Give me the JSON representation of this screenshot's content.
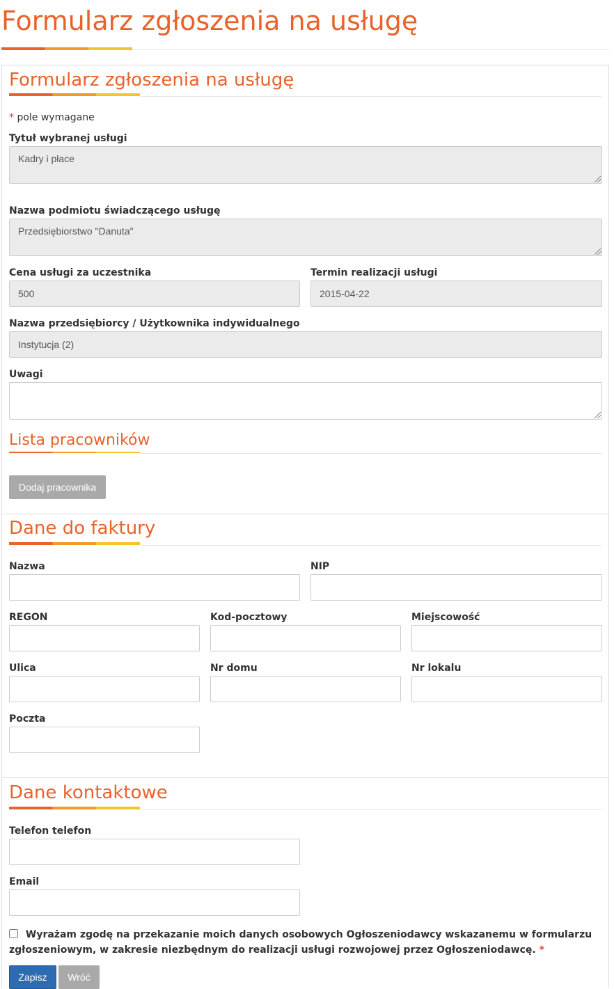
{
  "page": {
    "title": "Formularz zgłoszenia na usługę"
  },
  "form": {
    "title": "Formularz zgłoszenia na usługę",
    "required_note": "pole wymagane",
    "required_star": "*",
    "fields": {
      "service_title": {
        "label": "Tytuł wybranej usługi",
        "value": "Kadry i płace"
      },
      "provider_name": {
        "label": "Nazwa podmiotu świadczącego usługę",
        "value": "Przedsiębiorstwo \"Danuta\""
      },
      "price": {
        "label": "Cena usługi za uczestnika",
        "value": "500"
      },
      "deadline": {
        "label": "Termin realizacji usługi",
        "value": "2015-04-22"
      },
      "entrepreneur": {
        "label": "Nazwa przedsiębiorcy / Użytkownika indywidualnego",
        "value": "Instytucja (2)"
      },
      "notes": {
        "label": "Uwagi",
        "value": ""
      }
    }
  },
  "employees": {
    "title": "Lista pracowników",
    "add_button": "Dodaj pracownika"
  },
  "invoice": {
    "title": "Dane do faktury",
    "name": {
      "label": "Nazwa",
      "value": ""
    },
    "nip": {
      "label": "NIP",
      "value": ""
    },
    "regon": {
      "label": "REGON",
      "value": ""
    },
    "postal_code": {
      "label": "Kod-pocztowy",
      "value": ""
    },
    "city": {
      "label": "Miejscowość",
      "value": ""
    },
    "street": {
      "label": "Ulica",
      "value": ""
    },
    "house_no": {
      "label": "Nr domu",
      "value": ""
    },
    "apartment_no": {
      "label": "Nr lokalu",
      "value": ""
    },
    "post_office": {
      "label": "Poczta",
      "value": ""
    }
  },
  "contact": {
    "title": "Dane kontaktowe",
    "phone": {
      "label": "Telefon telefon",
      "value": ""
    },
    "email": {
      "label": "Email",
      "value": ""
    },
    "consent_text": "Wyrażam zgodę na przekazanie moich danych osobowych Ogłoszeniodawcy wskazanemu w formularzu zgłoszeniowym, w zakresie niezbędnym do realizacji usługi rozwojowej przez Ogłoszeniodawcę.",
    "consent_star": "*",
    "consent_checked": false
  },
  "actions": {
    "save": "Zapisz",
    "back": "Wróć"
  },
  "colors": {
    "accent": "#e8622a",
    "accent_mid": "#f09a2c",
    "accent_light": "#f5c42c",
    "primary_button": "#2e6cb2",
    "secondary_button": "#a9a9a9",
    "readonly_field": "#ebebeb"
  }
}
